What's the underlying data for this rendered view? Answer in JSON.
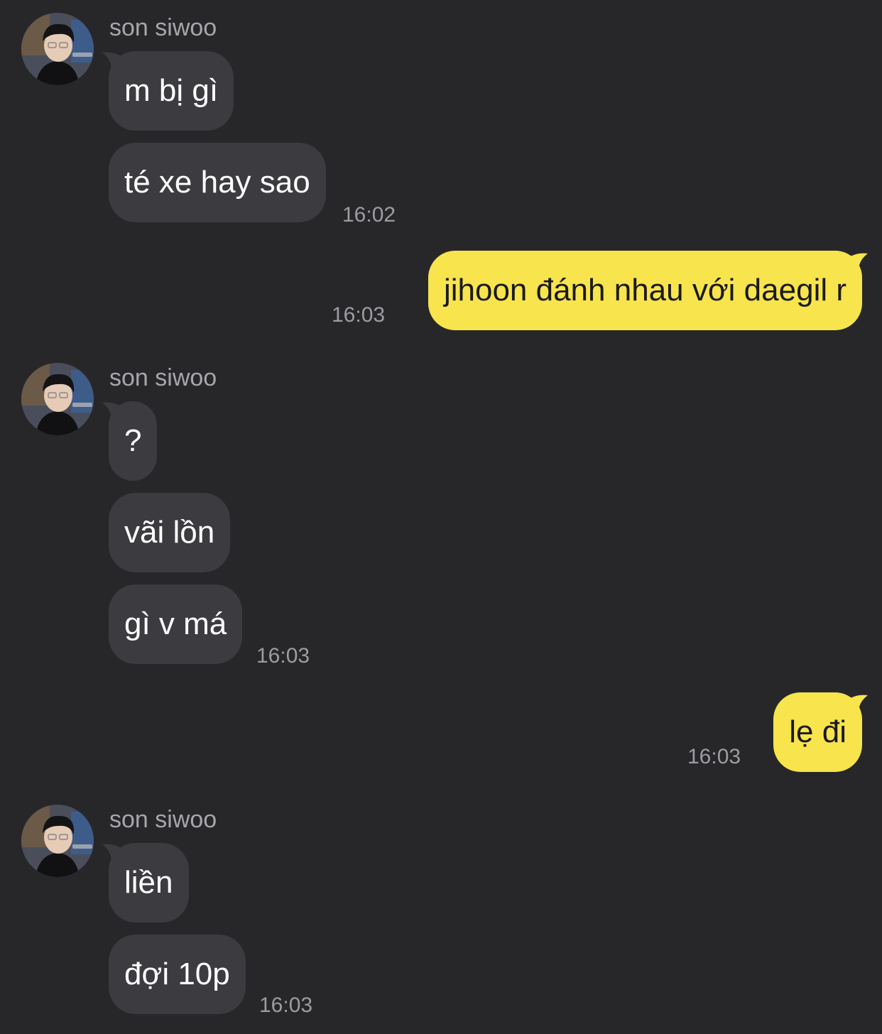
{
  "colors": {
    "background": "#27272a",
    "incoming_bubble": "#3c3c40",
    "outgoing_bubble": "#f8e44c",
    "timestamp": "#9c9ca1",
    "sender_name": "#a6a6ab"
  },
  "messages": [
    {
      "sender": "son siwoo",
      "avatar_icon": "profile-photo",
      "bubbles": [
        "m bị gì",
        "té xe hay sao"
      ],
      "time": "16:02"
    },
    {
      "sender": "me",
      "bubbles": [
        "jihoon đánh nhau với daegil r"
      ],
      "time": "16:03"
    },
    {
      "sender": "son siwoo",
      "avatar_icon": "profile-photo",
      "bubbles": [
        "?",
        "vãi lồn",
        "gì v má"
      ],
      "time": "16:03"
    },
    {
      "sender": "me",
      "bubbles": [
        "lẹ đi"
      ],
      "time": "16:03"
    },
    {
      "sender": "son siwoo",
      "avatar_icon": "profile-photo",
      "bubbles": [
        "liền",
        "đợi 10p"
      ],
      "time": "16:03"
    }
  ]
}
